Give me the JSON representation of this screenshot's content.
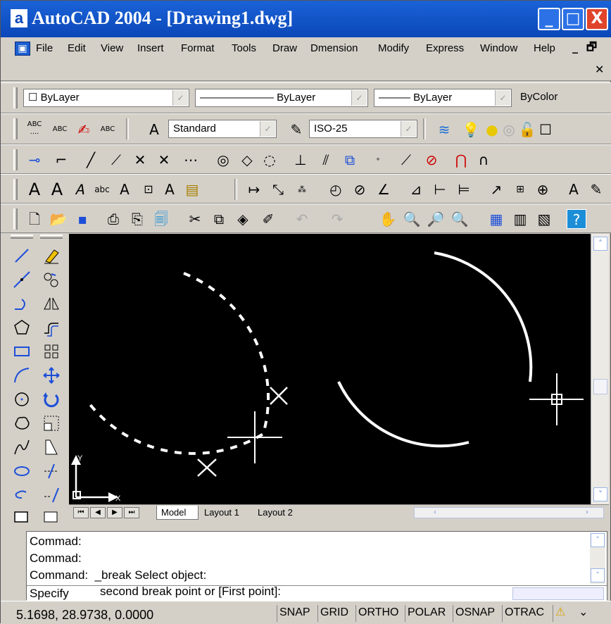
{
  "window": {
    "app_icon": "a",
    "title": "AutoCAD 2004 - [Drawing1.dwg]",
    "minimize_glyph": "_",
    "maximize_glyph": "□",
    "close_glyph": "X"
  },
  "menu": {
    "items": [
      "File",
      "Edit",
      "View",
      "Insert",
      "Format",
      "Tools",
      "Draw",
      "Dmension",
      "Modify",
      "Express",
      "Window",
      "Help"
    ],
    "doc_min": "_",
    "doc_restore": "🗗",
    "doc_close": "✕"
  },
  "properties_toolbar": {
    "layer_combo": "☐ ByLayer",
    "linetype_combo": "——————— ByLayer",
    "lineweight_combo": "——— ByLayer",
    "color_label": "ByColor"
  },
  "styles_toolbar": {
    "text_style": "Standard",
    "dim_style": "ISO-25"
  },
  "drawing": {
    "ucs_x_label": "X",
    "ucs_y_label": "Y"
  },
  "layout_tabs": [
    "Model",
    "Layout 1",
    "Layout 2"
  ],
  "command": {
    "history": [
      "Commad:",
      "Commad:",
      "Command:  _break Select object:"
    ],
    "prompt_prefix": "Specify",
    "prompt_text": "second break point or [First point]:"
  },
  "status": {
    "coordinates": "5.1698, 28.9738, 0.0000",
    "buttons": [
      "SNAP",
      "GRID",
      "ORTHO",
      "POLAR",
      "OSNAP",
      "OTRAC"
    ]
  },
  "colors": {
    "title_bar": "#1a63d8",
    "close_button": "#e0442a",
    "canvas": "#000000",
    "geometry": "#ffffff"
  }
}
